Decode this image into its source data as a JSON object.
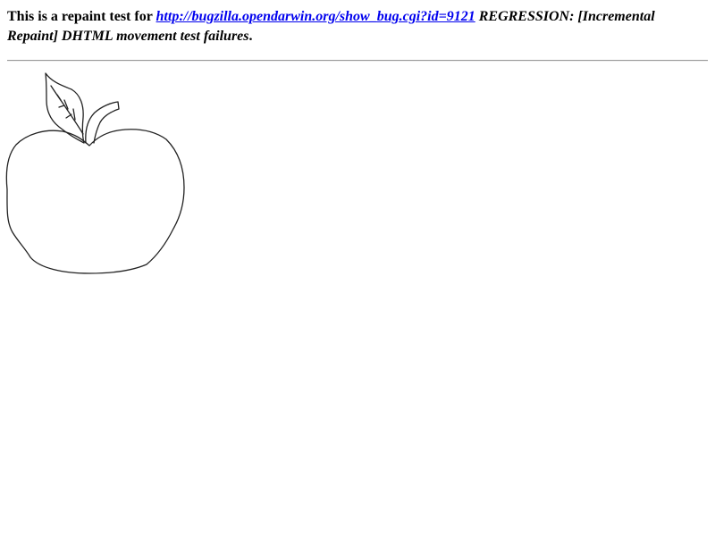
{
  "intro": {
    "prefix": "This is a repaint test for ",
    "link_text": "http://bugzilla.opendarwin.org/show_bug.cgi?id=9121",
    "link_href": "http://bugzilla.opendarwin.org/show_bug.cgi?id=9121",
    "suffix": " REGRESSION: [Incremental Repaint] DHTML movement test failures",
    "period": "."
  },
  "image": {
    "subject": "apple-drawing"
  },
  "colors": {
    "link": "#0000ee",
    "rule": "#9a9a9a",
    "stroke": "#222222"
  }
}
